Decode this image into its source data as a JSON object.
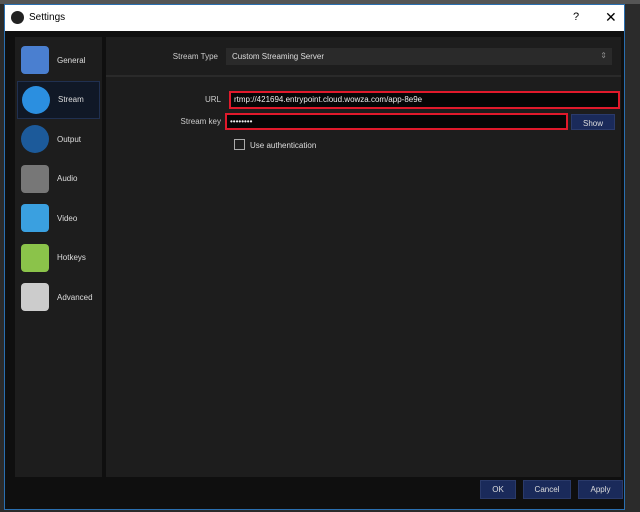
{
  "window": {
    "title": "Settings",
    "help": "?",
    "close": "✕"
  },
  "sidebar": {
    "items": [
      {
        "label": "General",
        "icon": "general-icon",
        "color": "#4a7fd0"
      },
      {
        "label": "Stream",
        "icon": "globe-icon",
        "color": "#2b8fe0",
        "selected": true
      },
      {
        "label": "Output",
        "icon": "broadcast-icon",
        "color": "#1c5a9a"
      },
      {
        "label": "Audio",
        "icon": "speaker-icon",
        "color": "#777777"
      },
      {
        "label": "Video",
        "icon": "monitor-icon",
        "color": "#3aa0e0"
      },
      {
        "label": "Hotkeys",
        "icon": "keyboard-icon",
        "color": "#8bc34a"
      },
      {
        "label": "Advanced",
        "icon": "gears-icon",
        "color": "#cccccc"
      }
    ]
  },
  "stream": {
    "type_label": "Stream Type",
    "type_value": "Custom Streaming Server",
    "url_label": "URL",
    "url_value": "rtmp://421694.entrypoint.cloud.wowza.com/app-8e9e",
    "key_label": "Stream key",
    "key_value": "••••••••",
    "show": "Show",
    "auth_label": "Use authentication",
    "auth_checked": false
  },
  "footer": {
    "ok": "OK",
    "cancel": "Cancel",
    "apply": "Apply"
  }
}
